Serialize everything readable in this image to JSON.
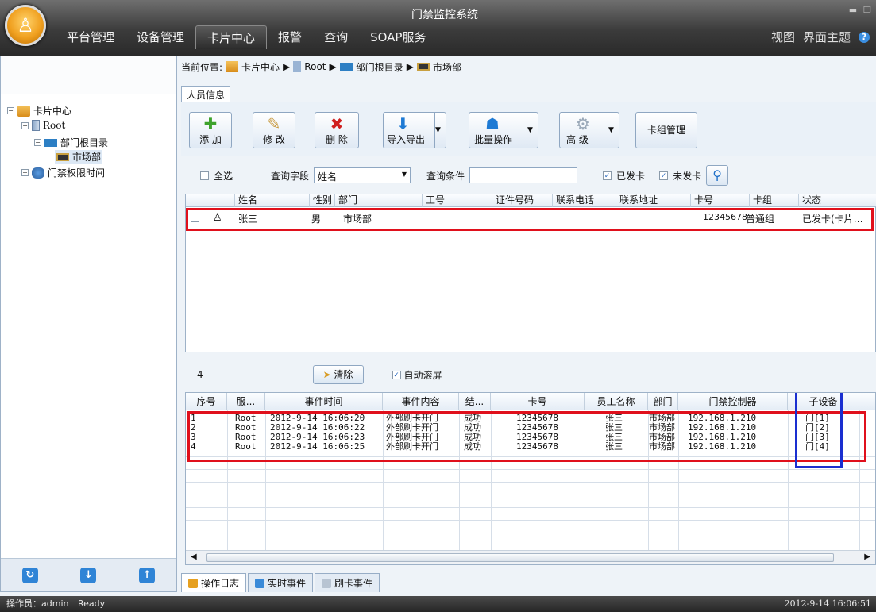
{
  "app": {
    "title": "门禁监控系统"
  },
  "menu": [
    "平台管理",
    "设备管理",
    "卡片中心",
    "报警",
    "查询",
    "SOAP服务"
  ],
  "menu_active": "卡片中心",
  "right_menu": {
    "view": "视图",
    "theme": "界面主题",
    "help": "?"
  },
  "tree": {
    "root": "卡片中心",
    "root_node": "Root",
    "dept_root": "部门根目录",
    "dept": "市场部",
    "access_time": "门禁权限时间"
  },
  "breadcrumb": {
    "label": "当前位置:",
    "items": [
      "卡片中心",
      "Root",
      "部门根目录",
      "市场部"
    ],
    "sep": "▶"
  },
  "tab_info": "人员信息",
  "toolbar": {
    "add": "添 加",
    "edit": "修 改",
    "delete": "删 除",
    "import": "导入导出",
    "batch": "批量操作",
    "advanced": "高 级",
    "card_group": "卡组管理"
  },
  "query": {
    "select_all": "全选",
    "field_label": "查询字段",
    "field_value": "姓名",
    "cond_label": "查询条件",
    "cond_value": "",
    "issued": "已发卡",
    "not_issued": "未发卡"
  },
  "person_columns": [
    "姓名",
    "性别",
    "部门",
    "工号",
    "证件号码",
    "联系电话",
    "联系地址",
    "卡号",
    "卡组",
    "状态"
  ],
  "person_rows": [
    {
      "name": "张三",
      "gender": "男",
      "dept": "市场部",
      "emp_no": "",
      "id_no": "",
      "phone": "",
      "address": "",
      "card": "12345678",
      "group": "普通组",
      "status": "已发卡(卡片…"
    }
  ],
  "event_bar": {
    "count": "4",
    "clear": "清除",
    "auto_scroll": "自动滚屏"
  },
  "event_columns": [
    "序号",
    "服...",
    "事件时间",
    "事件内容",
    "结...",
    "卡号",
    "员工名称",
    "部门",
    "门禁控制器",
    "子设备"
  ],
  "event_rows": [
    {
      "no": "1",
      "server": "Root",
      "time": "2012-9-14 16:06:20",
      "content": "外部刷卡开门",
      "result": "成功",
      "card": "12345678",
      "emp": "张三",
      "dept": "市场部",
      "controller": "192.168.1.210",
      "sub": "门[1]"
    },
    {
      "no": "2",
      "server": "Root",
      "time": "2012-9-14 16:06:22",
      "content": "外部刷卡开门",
      "result": "成功",
      "card": "12345678",
      "emp": "张三",
      "dept": "市场部",
      "controller": "192.168.1.210",
      "sub": "门[2]"
    },
    {
      "no": "3",
      "server": "Root",
      "time": "2012-9-14 16:06:23",
      "content": "外部刷卡开门",
      "result": "成功",
      "card": "12345678",
      "emp": "张三",
      "dept": "市场部",
      "controller": "192.168.1.210",
      "sub": "门[3]"
    },
    {
      "no": "4",
      "server": "Root",
      "time": "2012-9-14 16:06:25",
      "content": "外部刷卡开门",
      "result": "成功",
      "card": "12345678",
      "emp": "张三",
      "dept": "市场部",
      "controller": "192.168.1.210",
      "sub": "门[4]"
    }
  ],
  "bottom_tabs": [
    "操作日志",
    "实时事件",
    "刷卡事件"
  ],
  "status": {
    "operator": "操作员：admin",
    "state": "Ready",
    "datetime": "2012-9-14 16:06:51"
  },
  "colors": {
    "highlight_red": "#e0101c",
    "highlight_blue": "#1a2fd0",
    "accent": "#2f84d6"
  }
}
